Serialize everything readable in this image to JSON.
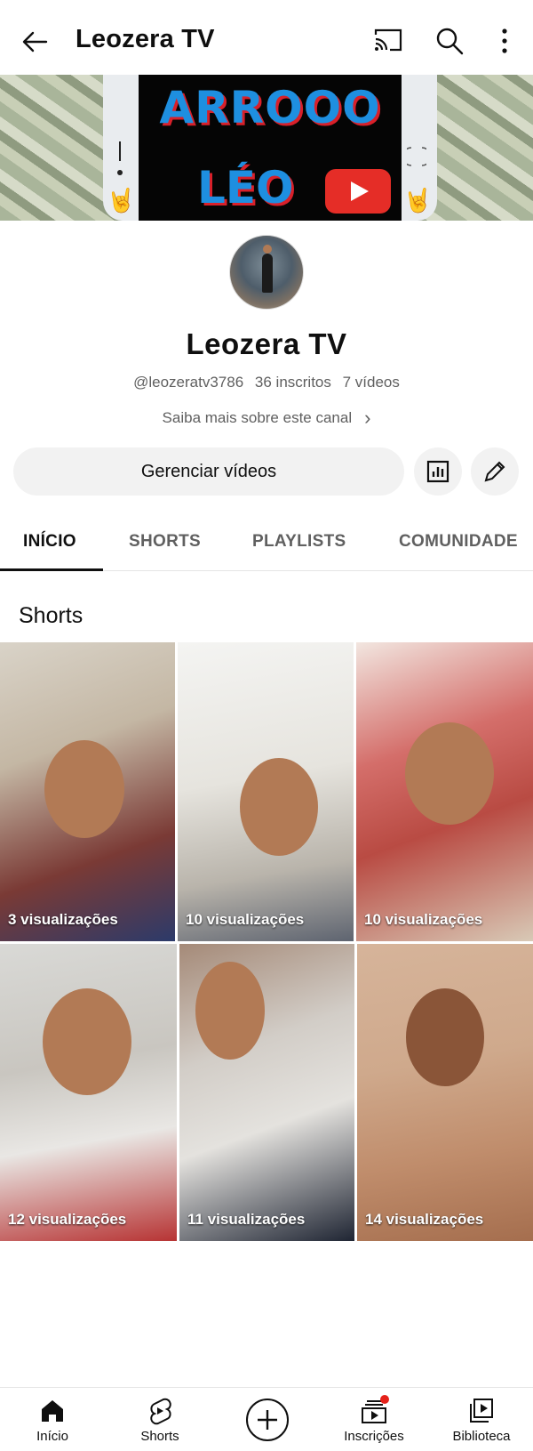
{
  "app_bar": {
    "title": "Leozera TV",
    "icons": [
      "back-arrow-icon",
      "cast-icon",
      "search-icon",
      "more-vert-icon"
    ]
  },
  "banner": {
    "line1": "ARROOO",
    "line2": "LÉO"
  },
  "channel": {
    "name": "Leozera TV",
    "handle": "@leozeratv3786",
    "subscribers": "36 inscritos",
    "videos": "7 vídeos",
    "about_link": "Saiba mais sobre este canal",
    "manage_button": "Gerenciar vídeos"
  },
  "tabs": [
    {
      "label": "INÍCIO",
      "active": true
    },
    {
      "label": "SHORTS",
      "active": false
    },
    {
      "label": "PLAYLISTS",
      "active": false
    },
    {
      "label": "COMUNIDADE",
      "active": false
    }
  ],
  "section": {
    "title": "Shorts"
  },
  "shorts": [
    {
      "views": "3 visualizações"
    },
    {
      "views": "10 visualizações"
    },
    {
      "views": "10 visualizações"
    },
    {
      "views": "12 visualizações"
    },
    {
      "views": "11 visualizações"
    },
    {
      "views": "14 visualizações"
    }
  ],
  "bottom_nav": [
    {
      "label": "Início",
      "icon": "home-icon",
      "active": true
    },
    {
      "label": "Shorts",
      "icon": "shorts-icon",
      "active": false
    },
    {
      "label": "",
      "icon": "create-plus-icon",
      "active": false
    },
    {
      "label": "Inscrições",
      "icon": "subscriptions-icon",
      "active": false,
      "badge": true
    },
    {
      "label": "Biblioteca",
      "icon": "library-icon",
      "active": false
    }
  ],
  "colors": {
    "text_primary": "#0f0f0f",
    "text_secondary": "#606060",
    "chip_bg": "#f2f2f2",
    "badge_red": "#e5211a"
  }
}
